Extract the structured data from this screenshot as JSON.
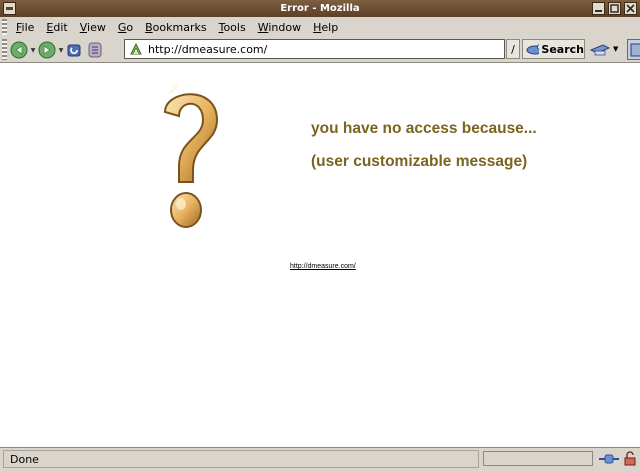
{
  "window": {
    "title": "Error - Mozilla"
  },
  "menubar": {
    "items": [
      {
        "label": "File",
        "underline": "F",
        "rest": "ile"
      },
      {
        "label": "Edit",
        "underline": "E",
        "rest": "dit"
      },
      {
        "label": "View",
        "underline": "V",
        "rest": "iew"
      },
      {
        "label": "Go",
        "underline": "G",
        "rest": "o"
      },
      {
        "label": "Bookmarks",
        "underline": "B",
        "rest": "ookmarks"
      },
      {
        "label": "Tools",
        "underline": "T",
        "rest": "ools"
      },
      {
        "label": "Window",
        "underline": "W",
        "rest": "indow"
      },
      {
        "label": "Help",
        "underline": "H",
        "rest": "elp"
      }
    ]
  },
  "navbar": {
    "url": "http://dmeasure.com/",
    "go_label": "/",
    "search_label": "Search"
  },
  "content": {
    "line1": "you have no access because...",
    "line2": "(user customizable message)",
    "link": "http://dmeasure.com/",
    "accent_color": "#7a6420"
  },
  "status": {
    "text": "Done"
  },
  "icons": [
    "back-arrow-icon",
    "forward-arrow-icon",
    "reload-icon",
    "stop-icon",
    "site-icon",
    "search-icon",
    "print-icon",
    "throbber-icon",
    "question-mark-icon",
    "online-icon",
    "security-lock-icon"
  ]
}
